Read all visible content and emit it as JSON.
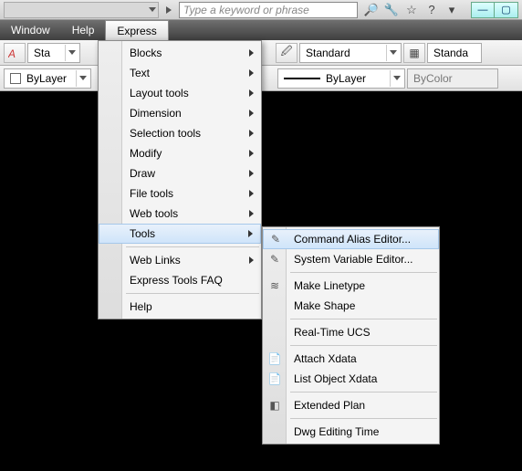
{
  "top": {
    "search_placeholder": "Type a keyword or phrase",
    "icons": [
      "binoculars",
      "wrench",
      "star",
      "help",
      "dropdown"
    ]
  },
  "menubar": {
    "items": [
      "Window",
      "Help",
      "Express"
    ],
    "active_index": 2
  },
  "toolbar1": {
    "style_a": "Sta",
    "style_b": "Standard",
    "style_c": "Standa"
  },
  "toolbar2": {
    "layer": "ByLayer",
    "lineweight": "ByLayer",
    "color": "ByColor"
  },
  "express_menu": [
    {
      "label": "Blocks",
      "sub": true
    },
    {
      "label": "Text",
      "sub": true
    },
    {
      "label": "Layout tools",
      "sub": true
    },
    {
      "label": "Dimension",
      "sub": true
    },
    {
      "label": "Selection tools",
      "sub": true
    },
    {
      "label": "Modify",
      "sub": true
    },
    {
      "label": "Draw",
      "sub": true
    },
    {
      "label": "File tools",
      "sub": true
    },
    {
      "label": "Web tools",
      "sub": true
    },
    {
      "label": "Tools",
      "sub": true,
      "hover": true
    },
    {
      "sep": true
    },
    {
      "label": "Web Links",
      "sub": true
    },
    {
      "label": "Express Tools FAQ"
    },
    {
      "sep": true
    },
    {
      "label": "Help"
    }
  ],
  "tools_submenu": [
    {
      "label": "Command Alias Editor...",
      "icon": "✎",
      "hover": true
    },
    {
      "label": "System Variable Editor...",
      "icon": "✎"
    },
    {
      "sep": true
    },
    {
      "label": "Make Linetype",
      "icon": "≋"
    },
    {
      "label": "Make Shape"
    },
    {
      "sep": true
    },
    {
      "label": "Real-Time UCS"
    },
    {
      "sep": true
    },
    {
      "label": "Attach Xdata",
      "icon": "📄"
    },
    {
      "label": "List Object Xdata",
      "icon": "📄"
    },
    {
      "sep": true
    },
    {
      "label": "Extended Plan",
      "icon": "◧"
    },
    {
      "sep": true
    },
    {
      "label": "Dwg Editing Time"
    }
  ]
}
